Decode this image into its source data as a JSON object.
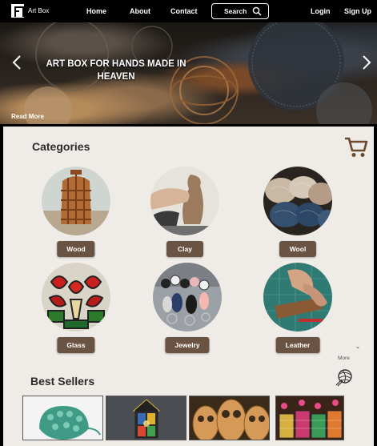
{
  "nav": {
    "logo_text": "Art Box",
    "home": "Home",
    "about": "About",
    "contact": "Contact",
    "search_label": "Search",
    "login": "Login",
    "signup": "Sign Up"
  },
  "hero": {
    "title": "ART BOX FOR HANDS MADE IN HEAVEN",
    "read_more": "Read More"
  },
  "categories": {
    "title": "Categories",
    "items": [
      {
        "label": "Wood",
        "icon": "wood-lantern-image"
      },
      {
        "label": "Clay",
        "icon": "clay-pottery-image"
      },
      {
        "label": "Wool",
        "icon": "wool-yarn-image"
      },
      {
        "label": "Glass",
        "icon": "stained-glass-image"
      },
      {
        "label": "Jewelry",
        "icon": "beaded-jewelry-image"
      },
      {
        "label": "Leather",
        "icon": "leather-craft-image"
      }
    ]
  },
  "more_label": "More",
  "best_sellers": {
    "title": "Best Sellers",
    "items": [
      "crochet-pouch-image",
      "glass-lantern-image",
      "wooden-owls-image",
      "woven-baskets-image"
    ]
  },
  "colors": {
    "nav_bg": "#000000",
    "panel_bg": "#efebe7",
    "button_brown": "#6a5342",
    "cart_brown": "#6b4a30"
  }
}
